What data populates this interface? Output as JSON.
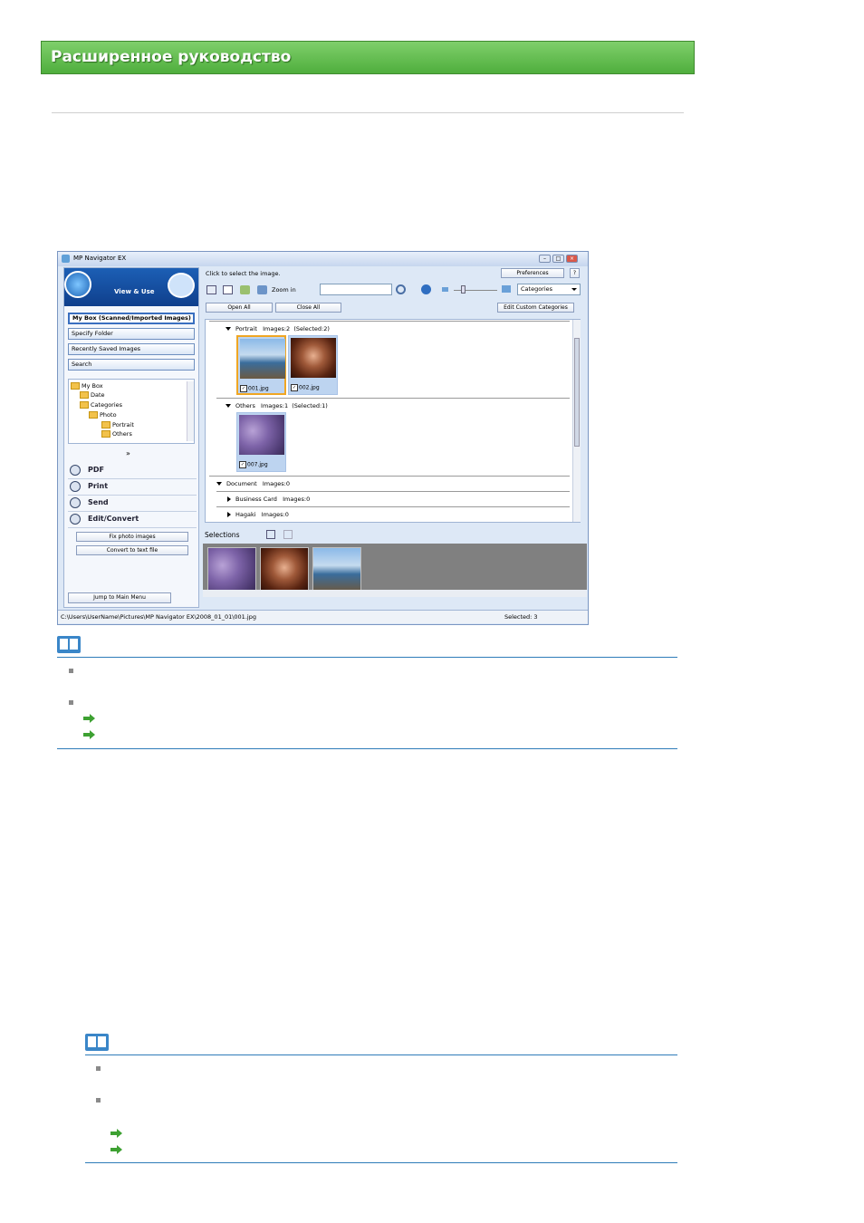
{
  "header": {
    "title": "Расширенное руководство"
  },
  "window": {
    "title": "MP Navigator EX",
    "view_use": "View & Use",
    "nav": {
      "my_box": "My Box (Scanned/Imported Images)",
      "specify_folder": "Specify Folder",
      "recently_saved": "Recently Saved Images",
      "search": "Search"
    },
    "tree": [
      "My Box",
      "Date",
      "Categories",
      "Photo",
      "Portrait",
      "Others"
    ],
    "expand_glyph": "»",
    "actions": {
      "pdf": "PDF",
      "print": "Print",
      "send": "Send",
      "edit_convert": "Edit/Convert"
    },
    "sub_buttons": {
      "fix_photo": "Fix photo images",
      "convert_text": "Convert to text file"
    },
    "jump_main": "Jump to Main Menu",
    "hint": "Click to select the image.",
    "preferences": "Preferences",
    "help": "?",
    "zoom_in": "Zoom in",
    "category_select": "Categories",
    "open_all": "Open All",
    "close_all": "Close All",
    "edit_custom": "Edit Custom Categories",
    "groups": [
      {
        "name": "Portrait",
        "count": "Images:2",
        "selected": "(Selected:2)"
      },
      {
        "name": "Others",
        "count": "Images:1",
        "selected": "(Selected:1)"
      },
      {
        "name": "Document",
        "count": "Images:0"
      },
      {
        "name": "Business Card",
        "count": "Images:0"
      },
      {
        "name": "Hagaki",
        "count": "Images:0"
      }
    ],
    "files": {
      "f1": "001.jpg",
      "f2": "002.jpg",
      "f3": "007.jpg"
    },
    "check_mark": "✓",
    "selections_label": "Selections",
    "status_path": "C:\\Users\\UserName\\Pictures\\MP Navigator EX\\2008_01_01\\001.jpg",
    "status_selected": "Selected: 3"
  }
}
